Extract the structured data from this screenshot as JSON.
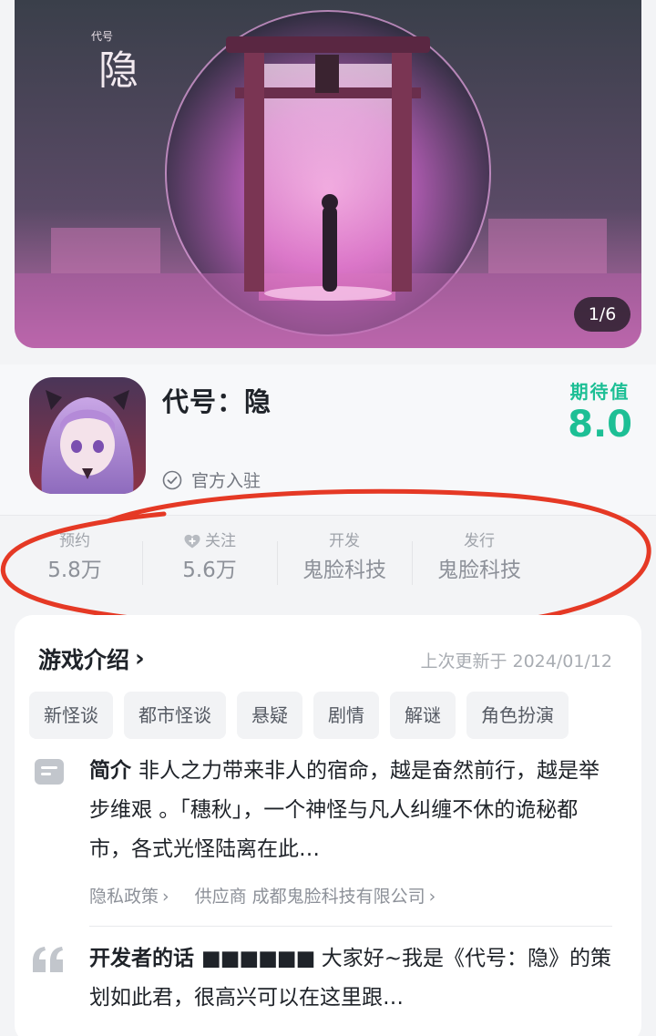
{
  "banner": {
    "art_text_small": "代号",
    "art_text_big": "隐",
    "pager": "1/6"
  },
  "app": {
    "title": "代号：隐",
    "official_label": "官方入驻",
    "expect_label": "期待值",
    "expect_value": "8.0"
  },
  "stats": [
    {
      "label": "预约",
      "value": "5.8万"
    },
    {
      "label": "关注",
      "value": "5.6万"
    },
    {
      "label": "开发",
      "value": "鬼脸科技"
    },
    {
      "label": "发行",
      "value": "鬼脸科技"
    }
  ],
  "intro": {
    "heading": "游戏介绍",
    "chevron": "›",
    "updated": "上次更新于 2024/01/12",
    "tags": [
      "新怪谈",
      "都市怪谈",
      "悬疑",
      "剧情",
      "解谜",
      "角色扮演"
    ],
    "summary_lead": "简介",
    "summary_text": "非人之力带来非人的宿命，越是奋然前行，越是举步维艰 。「穗秋」，一个神怪与凡人纠缠不休的诡秘都市，各式光怪陆离在此…",
    "privacy_link": "隐私政策",
    "supplier_link": "供应商 成都鬼脸科技有限公司",
    "dev_lead": "开发者的话",
    "dev_redacted": "■■■■■■",
    "dev_text": "大家好~我是《代号：隐》的策划如此君，很高兴可以在这里跟…"
  },
  "icons": {
    "check": "check-circle-icon",
    "heart": "heart-plus-icon",
    "summary": "document-icon",
    "quote": "quote-icon",
    "accent": "#1dbf95"
  }
}
